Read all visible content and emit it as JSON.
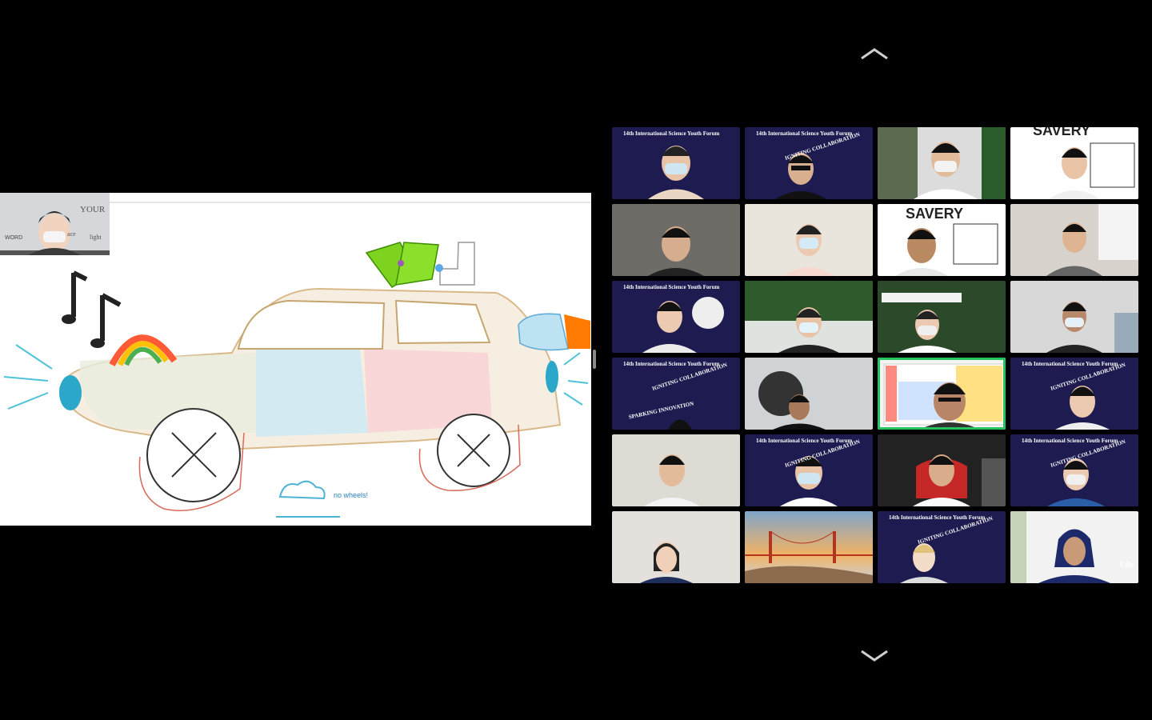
{
  "share": {
    "annotation_text": "no wheels!",
    "presenter_wall_words": [
      "YOUR",
      "ace",
      "WORD",
      "light"
    ]
  },
  "gallery": {
    "banner_title": "14th International Science Youth Forum",
    "banner_collab": "IGNITING COLLABORATION",
    "banner_spark": "SPARKING INNOVATION",
    "bg_saverty_top": "SAVERY",
    "bg_saverty": "SAVERY",
    "name_label": "Edis"
  },
  "colors": {
    "banner": "#1d1b4f",
    "active_speaker": "#22c55e"
  },
  "icons": {
    "up": "chevron-up-icon",
    "down": "chevron-down-icon"
  }
}
